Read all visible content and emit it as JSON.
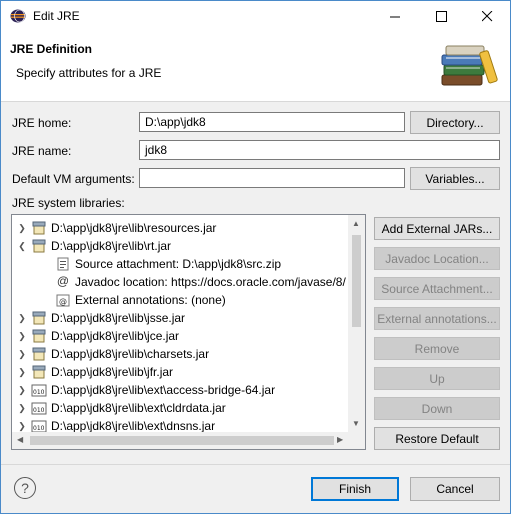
{
  "window": {
    "title": "Edit JRE"
  },
  "header": {
    "title": "JRE Definition",
    "subtitle": "Specify attributes for a JRE"
  },
  "form": {
    "jre_home_label": "JRE home:",
    "jre_home_value": "D:\\app\\jdk8",
    "directory_button": "Directory...",
    "jre_name_label": "JRE name:",
    "jre_name_value": "jdk8",
    "vm_args_label": "Default VM arguments:",
    "vm_args_value": "",
    "variables_button": "Variables...",
    "libraries_label": "JRE system libraries:"
  },
  "libraries": {
    "items": [
      {
        "label": "D:\\app\\jdk8\\jre\\lib\\resources.jar",
        "state": "collapsed"
      },
      {
        "label": "D:\\app\\jdk8\\jre\\lib\\rt.jar",
        "state": "expanded"
      },
      {
        "label": "Source attachment: D:\\app\\jdk8\\src.zip",
        "kind": "source"
      },
      {
        "label": "Javadoc location: https://docs.oracle.com/javase/8/",
        "kind": "javadoc"
      },
      {
        "label": "External annotations: (none)",
        "kind": "annotations"
      },
      {
        "label": "D:\\app\\jdk8\\jre\\lib\\jsse.jar",
        "state": "collapsed"
      },
      {
        "label": "D:\\app\\jdk8\\jre\\lib\\jce.jar",
        "state": "collapsed"
      },
      {
        "label": "D:\\app\\jdk8\\jre\\lib\\charsets.jar",
        "state": "collapsed"
      },
      {
        "label": "D:\\app\\jdk8\\jre\\lib\\jfr.jar",
        "state": "collapsed"
      },
      {
        "label": "D:\\app\\jdk8\\jre\\lib\\ext\\access-bridge-64.jar",
        "state": "collapsed"
      },
      {
        "label": "D:\\app\\jdk8\\jre\\lib\\ext\\cldrdata.jar",
        "state": "collapsed"
      },
      {
        "label": "D:\\app\\jdk8\\jre\\lib\\ext\\dnsns.jar",
        "state": "collapsed"
      }
    ]
  },
  "side_buttons": {
    "add_external_jars": "Add External JARs...",
    "javadoc_location": "Javadoc Location...",
    "source_attachment": "Source Attachment...",
    "external_annotations": "External annotations...",
    "remove": "Remove",
    "up": "Up",
    "down": "Down",
    "restore_default": "Restore Default"
  },
  "footer": {
    "finish": "Finish",
    "cancel": "Cancel",
    "help_icon": "?"
  },
  "colors": {
    "accent": "#0078d7",
    "disabled_text": "#838383"
  }
}
